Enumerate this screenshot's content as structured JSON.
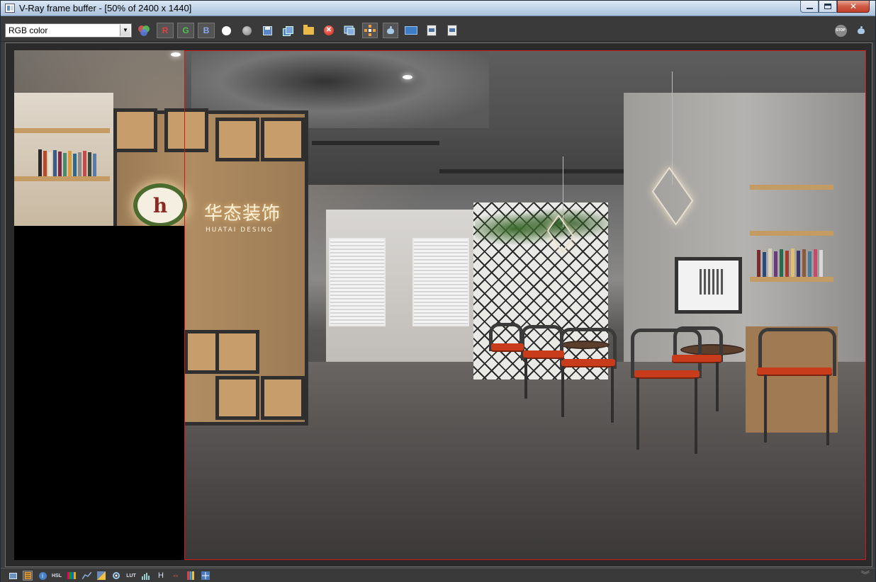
{
  "window": {
    "title": "V-Ray frame buffer - [50% of 2400 x 1440]",
    "controls": {
      "minimize": "minimize",
      "maximize": "maximize",
      "close": "✕"
    }
  },
  "toolbar": {
    "channel_select": {
      "value": "RGB color"
    },
    "buttons": {
      "red_channel": "R",
      "green_channel": "G",
      "blue_channel": "B"
    },
    "icons": [
      "color-channels-icon",
      "white-circle-icon",
      "gray-circle-icon",
      "save-icon",
      "copy-icon",
      "open-folder-icon",
      "clear-image-icon",
      "region-render-icon",
      "track-mouse-icon",
      "render-teapot-icon",
      "compare-icon",
      "history-a-icon",
      "history-b-icon",
      "stop-render-icon",
      "render-icon"
    ],
    "stop_label": "STOP"
  },
  "render": {
    "logo_mark": "h",
    "logo_text": "华态装饰",
    "logo_subtext": "HUATAI DESING",
    "region_color": "#d01818"
  },
  "statusbar": {
    "icons": [
      "display-colors-icon",
      "color-corrections-icon",
      "info-icon",
      "hsl-icon",
      "levels-icon",
      "curve-icon",
      "exposure-icon",
      "lens-effects-icon",
      "lut-icon",
      "histogram-icon",
      "h-icon",
      "stereo-icon",
      "color-bars-icon",
      "sharpen-icon"
    ],
    "labels": {
      "hsl": "HSL",
      "lut": "LUT",
      "h": "H"
    },
    "chevron": "︾"
  }
}
